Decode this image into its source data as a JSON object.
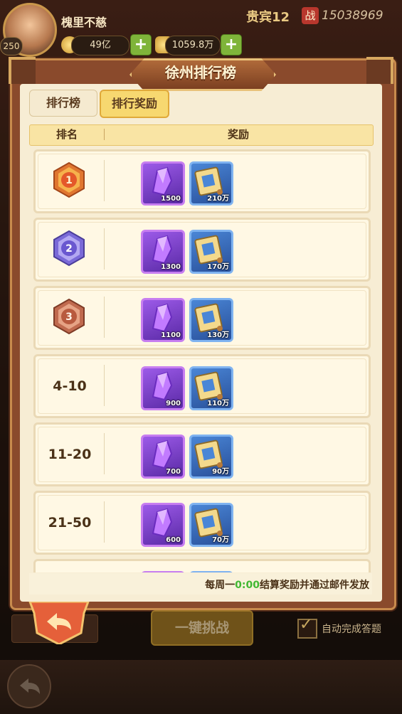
{
  "hud": {
    "level": "250",
    "player_name": "槐里不慈",
    "vip": "贵宾12",
    "power_icon": "战",
    "power": "15038969",
    "silver": "49亿",
    "gold": "1059.8万",
    "plus": "+"
  },
  "dialog": {
    "title": "徐州排行榜",
    "tabs": [
      {
        "label": "排行榜",
        "active": false
      },
      {
        "label": "排行奖励",
        "active": true
      }
    ],
    "headers": {
      "rank": "排名",
      "reward": "奖励"
    },
    "rows": [
      {
        "rank": "1",
        "medal": "gold",
        "gem": "1500",
        "book": "210万"
      },
      {
        "rank": "2",
        "medal": "purple",
        "gem": "1300",
        "book": "170万"
      },
      {
        "rank": "3",
        "medal": "bronze",
        "gem": "1100",
        "book": "130万"
      },
      {
        "rank": "4-10",
        "gem": "900",
        "book": "110万"
      },
      {
        "rank": "11-20",
        "gem": "700",
        "book": "90万"
      },
      {
        "rank": "21-50",
        "gem": "600",
        "book": "70万"
      }
    ],
    "footer": {
      "prefix": "每周一",
      "time": "0:00",
      "suffix": "结算奖励并通过邮件发放"
    }
  },
  "bottom": {
    "challenge_label": "一键挑战",
    "auto_answer_label": "自动完成答题"
  },
  "colors": {
    "accent": "#f7d870",
    "frame": "#8a4a2c",
    "highlight_green": "#41b833"
  }
}
